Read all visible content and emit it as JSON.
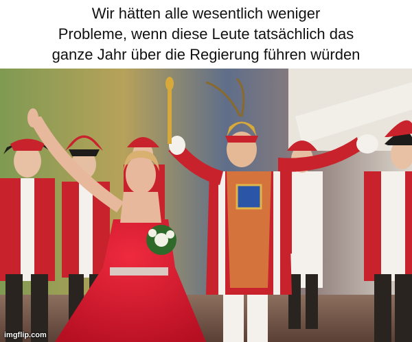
{
  "caption": {
    "line1": "Wir hätten alle wesentlich weniger",
    "line2": "Probleme, wenn diese Leute tatsächlich das",
    "line3": "ganze Jahr über die Regierung führen würden"
  },
  "watermark": "imgflip.com",
  "colors": {
    "uniform_red": "#c8232c",
    "dress_red": "#d8142a",
    "gold": "#d6a93a",
    "white": "#f4f1ec",
    "backdrop_green": "#6f8a4a"
  }
}
